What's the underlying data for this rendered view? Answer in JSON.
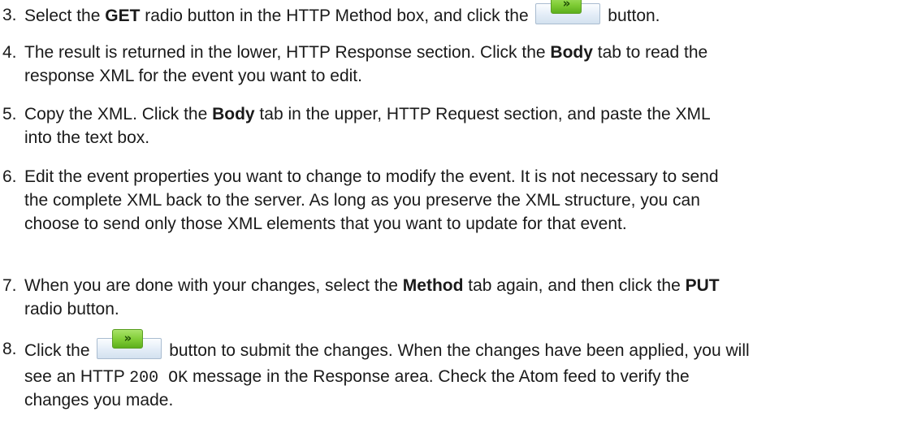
{
  "steps": [
    {
      "number": "3.",
      "parts": {
        "a": "Select the ",
        "b_get": "GET",
        "c": " radio button in the HTTP Method box, and click the ",
        "d": " button."
      }
    },
    {
      "number": "4.",
      "parts": {
        "a": "The result is returned in the lower, HTTP Response section. Click the ",
        "b_body": "Body",
        "c": " tab to read the",
        "d": "response XML for the event you want to edit."
      }
    },
    {
      "number": "5.",
      "parts": {
        "a": "Copy the XML. Click the ",
        "b_body": "Body",
        "c": " tab in the upper, HTTP Request section, and paste the XML",
        "d": "into the text box."
      }
    },
    {
      "number": "6.",
      "lines": [
        "Edit the event properties you want to change to modify the event. It is not necessary to send",
        "the complete XML back to the server. As long as you preserve the XML structure, you can",
        "choose to send only those XML elements that you want to update for that event."
      ]
    },
    {
      "number": "7.",
      "parts": {
        "a": "When you are done with your changes, select the ",
        "b_method": "Method",
        "c": " tab again, and then click the ",
        "b_put": "PUT",
        "d": "radio button."
      }
    },
    {
      "number": "8.",
      "parts": {
        "a": "Click the ",
        "b": " button to submit the changes. When the changes have been applied, you will",
        "c": "see an HTTP ",
        "code": "200 OK",
        "d": " message in the Response area. Check the Atom feed to verify the",
        "e": "changes you made."
      }
    }
  ],
  "button": {
    "glyph": "»",
    "icon": "double-chevron-right-icon",
    "colors": {
      "frame": "#d3e1ef",
      "chevron": "#7fcc35"
    }
  }
}
